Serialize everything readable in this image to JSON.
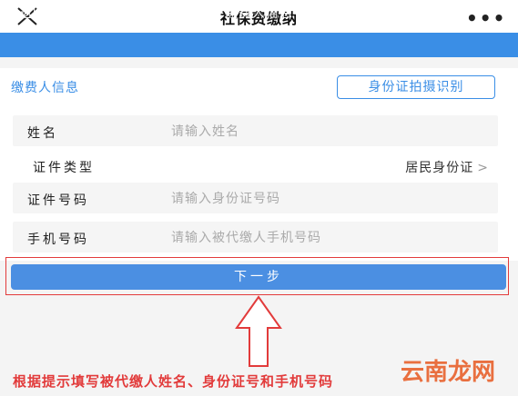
{
  "app": {
    "title": "社保费缴纳",
    "more_label": "•••"
  },
  "nav": {
    "back_label": "返回",
    "title": "缴费人信息"
  },
  "section": {
    "title": "缴费人信息",
    "scan_button": "身份证拍摄识别"
  },
  "form": {
    "name_label": "姓名",
    "name_placeholder": "请输入姓名",
    "idtype_label": "证件类型",
    "idtype_value": "居民身份证",
    "idtype_chevron": ">",
    "idnum_label": "证件号码",
    "idnum_placeholder": "请输入身份证号码",
    "phone_label": "手机号码",
    "phone_placeholder": "请输入被代缴人手机号码"
  },
  "next_button": "下一步",
  "annotation": "根据提示填写被代缴人姓名、身份证号和手机号码",
  "watermark": "云南龙网",
  "colors": {
    "accent": "#3a8ee6",
    "annotation_red": "#e23b3b"
  }
}
